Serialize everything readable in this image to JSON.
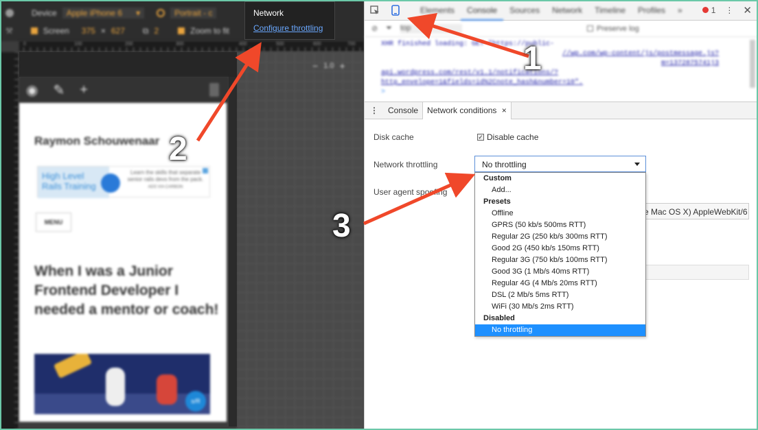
{
  "device_toolbar": {
    "device_label": "Device",
    "device_value": "Apple iPhone 6",
    "orientation_value": "Portrait - c",
    "screen_label": "Screen",
    "width": "375",
    "times": "×",
    "height": "627",
    "dpr": "2",
    "zoom_to_fit": "Zoom to fit"
  },
  "ruler_ticks": [
    "0",
    "100",
    "200",
    "300",
    "400",
    "500",
    "600",
    "700"
  ],
  "zoom_level": "1.0",
  "network_popup": {
    "title": "Network",
    "link": "Configure throttling"
  },
  "phone_page": {
    "site_title": "Raymon Schouwenaar",
    "ad_left_text": "High Level Rails Training",
    "ad_right_text": "Learn the skills that separate senior rails devs from the pack.",
    "ad_source": "ADS VIA CARBON",
    "menu_label": "MENU",
    "headline": "When I was a Junior Frontend Developer I needed a mentor or coach!",
    "badge": "s/R"
  },
  "devtools": {
    "tabs": [
      "Elements",
      "Console",
      "Sources",
      "Network",
      "Timeline",
      "Profiles"
    ],
    "active_tab": "Console",
    "more": "»",
    "error_count": "1",
    "filter_placeholder": "top",
    "preserve_log": "Preserve log",
    "console_lines": [
      "XHR finished loading: GET \"https://public-",
      "//wp.com/wp-content/js/postmessage.js?",
      "m=1372875741j3",
      "api.wordpress.com/rest/v1.1/notifications/?",
      "http_envelope=1&fields=id%2Cnote_hash&number=10\"."
    ],
    "prompt": ">",
    "drawer_tabs": [
      "Console",
      "Network conditions"
    ],
    "drawer_active": "Network conditions",
    "drawer_close": "×",
    "disk_cache_label": "Disk cache",
    "disable_cache_label": "Disable cache",
    "disable_cache_checked": true,
    "network_throttling_label": "Network throttling",
    "throttle_selected": "No throttling",
    "user_agent_label": "User agent spoofing",
    "user_agent_value": "e Mac OS X) AppleWebKit/6",
    "throttle_options": [
      {
        "type": "group",
        "label": "Custom"
      },
      {
        "type": "option",
        "label": "Add..."
      },
      {
        "type": "group",
        "label": "Presets"
      },
      {
        "type": "option",
        "label": "Offline"
      },
      {
        "type": "option",
        "label": "GPRS (50 kb/s 500ms RTT)"
      },
      {
        "type": "option",
        "label": "Regular 2G (250 kb/s 300ms RTT)"
      },
      {
        "type": "option",
        "label": "Good 2G (450 kb/s 150ms RTT)"
      },
      {
        "type": "option",
        "label": "Regular 3G (750 kb/s 100ms RTT)"
      },
      {
        "type": "option",
        "label": "Good 3G (1 Mb/s 40ms RTT)"
      },
      {
        "type": "option",
        "label": "Regular 4G (4 Mb/s 20ms RTT)"
      },
      {
        "type": "option",
        "label": "DSL (2 Mb/s 5ms RTT)"
      },
      {
        "type": "option",
        "label": "WiFi (30 Mb/s 2ms RTT)"
      },
      {
        "type": "group",
        "label": "Disabled"
      },
      {
        "type": "option",
        "label": "No throttling",
        "selected": true
      }
    ]
  },
  "annotations": {
    "step1": "1",
    "step2": "2",
    "step3": "3",
    "arrow_color": "#f0482a"
  },
  "colors": {
    "accent": "#1e90ff",
    "devtools_tab_active": "#3c8cf4",
    "device_toolbar_accent": "#e8a33d",
    "error": "#e53935"
  }
}
